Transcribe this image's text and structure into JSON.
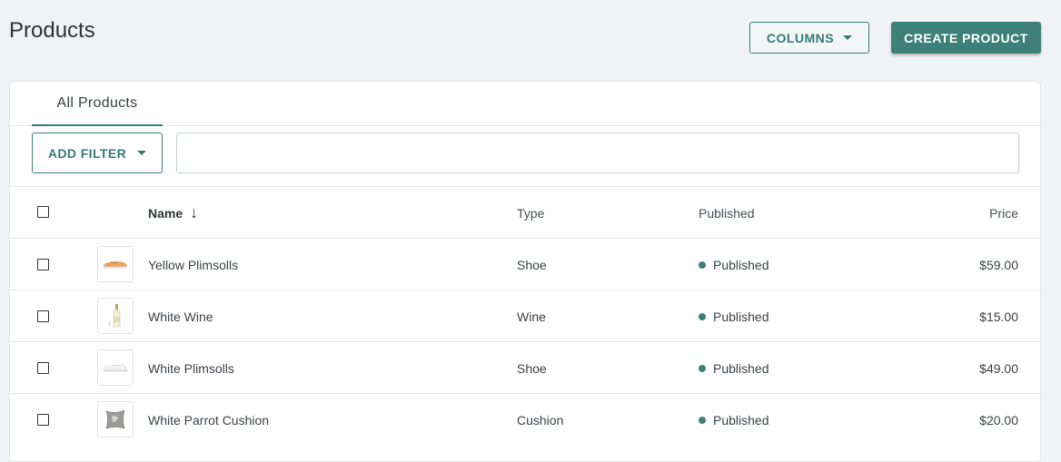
{
  "header": {
    "title": "Products",
    "columns_label": "COLUMNS",
    "create_label": "CREATE PRODUCT"
  },
  "tabs": [
    {
      "label": "All Products"
    }
  ],
  "filter": {
    "add_filter_label": "ADD FILTER",
    "search_value": "",
    "search_placeholder": ""
  },
  "table": {
    "columns": {
      "name": "Name",
      "type": "Type",
      "published": "Published",
      "price": "Price"
    },
    "sort": {
      "column": "Name",
      "direction": "descending-arrow"
    },
    "rows": [
      {
        "name": "Yellow Plimsolls",
        "type": "Shoe",
        "status": "Published",
        "price": "$59.00",
        "thumb_icon": "yellow-plimsoll-thumbnail"
      },
      {
        "name": "White Wine",
        "type": "Wine",
        "status": "Published",
        "price": "$15.00",
        "thumb_icon": "wine-bottle-thumbnail"
      },
      {
        "name": "White Plimsolls",
        "type": "Shoe",
        "status": "Published",
        "price": "$49.00",
        "thumb_icon": "white-plimsoll-thumbnail"
      },
      {
        "name": "White Parrot Cushion",
        "type": "Cushion",
        "status": "Published",
        "price": "$20.00",
        "thumb_icon": "cushion-thumbnail"
      }
    ]
  },
  "colors": {
    "accent": "#3d8078",
    "background": "#eff3f5",
    "published_dot": "#3d8078"
  }
}
